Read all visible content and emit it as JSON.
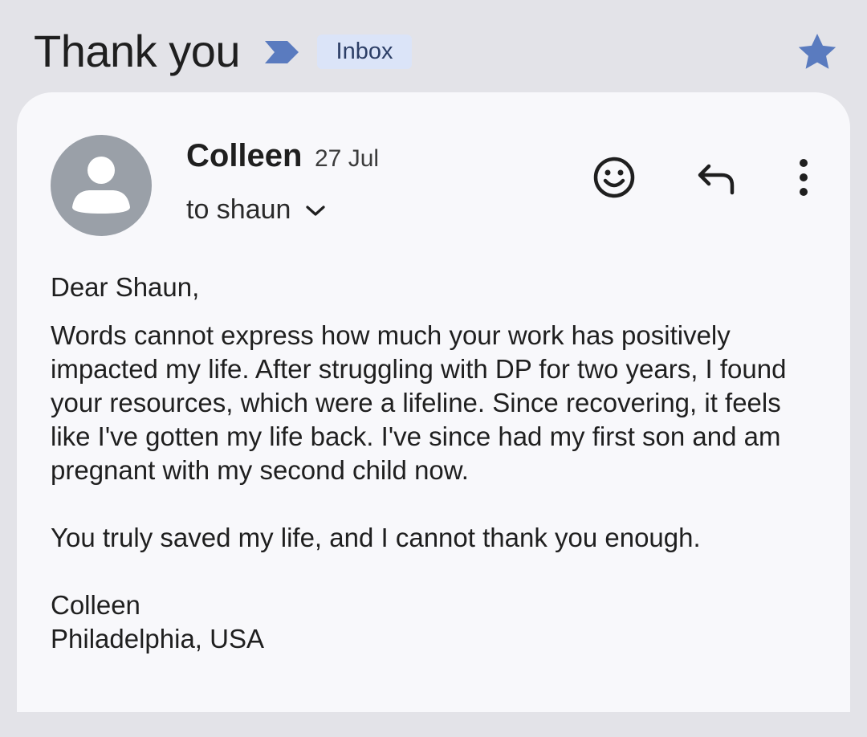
{
  "email": {
    "subject": "Thank you",
    "label": "Inbox",
    "starred": true,
    "sender": {
      "name": "Colleen",
      "date": "27 Jul",
      "recipient": "to shaun"
    },
    "body": {
      "greeting": "Dear Shaun,",
      "paragraph1": "Words cannot express how much your work has positively impacted my life. After struggling with DP for two years, I found your resources, which were a lifeline. Since recovering, it feels like I've gotten my life back. I've since had my first son and am pregnant with my second child now.",
      "paragraph2": "You truly saved my life, and I cannot thank you enough.",
      "signature_name": "Colleen",
      "signature_location": "Philadelphia, USA"
    }
  },
  "colors": {
    "background": "#e3e3e8",
    "card": "#f8f8fb",
    "accent": "#5a7bbf",
    "label_chip": "#dbe4f8",
    "avatar": "#9aa0a8"
  },
  "icons": {
    "importance": "importance-marker-icon",
    "star": "star-icon",
    "emoji": "emoji-reaction-icon",
    "reply": "reply-icon",
    "more": "more-vertical-icon",
    "avatar": "person-avatar-icon",
    "chevron": "chevron-down-icon"
  }
}
